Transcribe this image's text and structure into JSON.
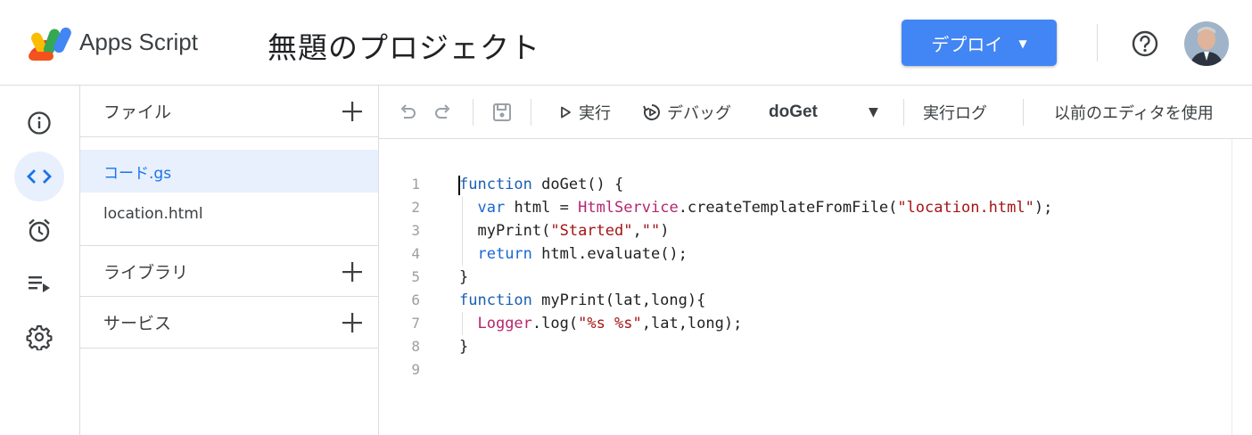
{
  "header": {
    "app_name": "Apps Script",
    "project_title": "無題のプロジェクト",
    "deploy_label": "デプロイ",
    "deploy_color": "#4285f4"
  },
  "rail": {
    "items": [
      {
        "name": "overview",
        "icon": "info-icon"
      },
      {
        "name": "editor",
        "icon": "code-icon",
        "active": true
      },
      {
        "name": "triggers",
        "icon": "alarm-icon"
      },
      {
        "name": "executions",
        "icon": "executions-icon"
      },
      {
        "name": "settings",
        "icon": "gear-icon"
      }
    ]
  },
  "files": {
    "files_label": "ファイル",
    "items": [
      "コード.gs",
      "location.html"
    ],
    "libraries_label": "ライブラリ",
    "services_label": "サービス"
  },
  "toolbar": {
    "run_label": "実行",
    "debug_label": "デバッグ",
    "function_name": "doGet",
    "log_label": "実行ログ",
    "legacy_label": "以前のエディタを使用"
  },
  "editor": {
    "line_numbers": [
      "1",
      "2",
      "3",
      "4",
      "5",
      "6",
      "7",
      "8",
      "9"
    ],
    "lines": [
      [
        {
          "t": "function",
          "c": "kw"
        },
        {
          "t": " doGet() {",
          "c": ""
        }
      ],
      [
        {
          "t": "  ",
          "c": ""
        },
        {
          "t": "var",
          "c": "kw2"
        },
        {
          "t": " html = ",
          "c": ""
        },
        {
          "t": "HtmlService",
          "c": "cls"
        },
        {
          "t": ".createTemplateFromFile(",
          "c": ""
        },
        {
          "t": "\"location.html\"",
          "c": "str"
        },
        {
          "t": ");",
          "c": ""
        }
      ],
      [
        {
          "t": "  myPrint(",
          "c": ""
        },
        {
          "t": "\"Started\"",
          "c": "str"
        },
        {
          "t": ",",
          "c": ""
        },
        {
          "t": "\"\"",
          "c": "str"
        },
        {
          "t": ")",
          "c": ""
        }
      ],
      [
        {
          "t": "  ",
          "c": ""
        },
        {
          "t": "return",
          "c": "kw2"
        },
        {
          "t": " html.evaluate();",
          "c": ""
        }
      ],
      [
        {
          "t": "}",
          "c": ""
        }
      ],
      [
        {
          "t": "function",
          "c": "kw"
        },
        {
          "t": " myPrint(lat,long){",
          "c": ""
        }
      ],
      [
        {
          "t": "  ",
          "c": ""
        },
        {
          "t": "Logger",
          "c": "cls"
        },
        {
          "t": ".log(",
          "c": ""
        },
        {
          "t": "\"%s %s\"",
          "c": "str"
        },
        {
          "t": ",lat,long);",
          "c": ""
        }
      ],
      [
        {
          "t": "}",
          "c": ""
        }
      ],
      [
        {
          "t": "",
          "c": ""
        }
      ]
    ]
  }
}
